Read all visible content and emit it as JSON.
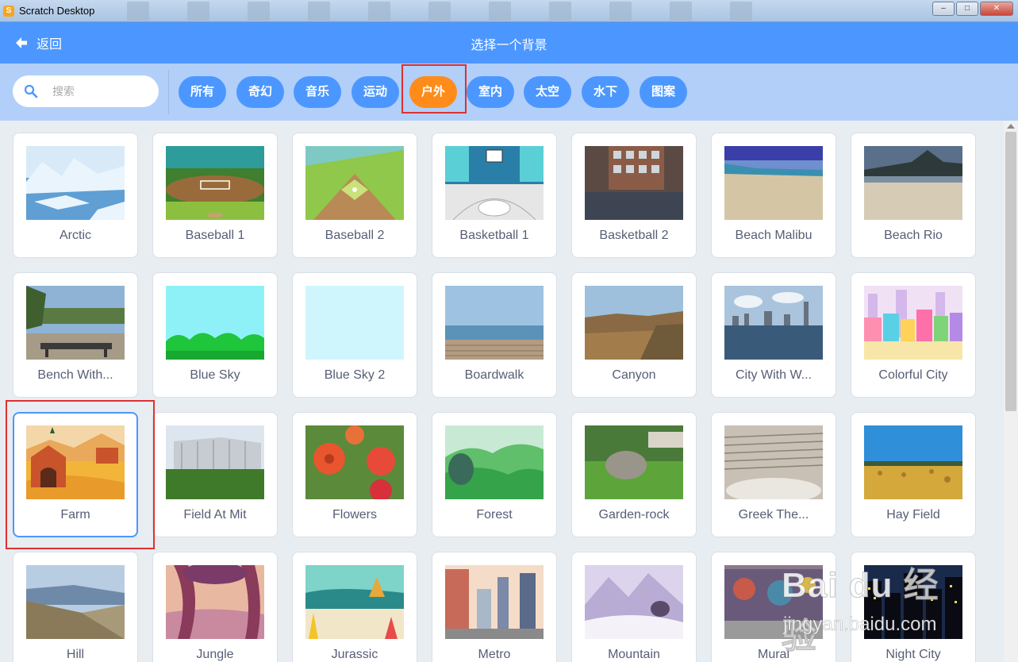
{
  "window": {
    "title": "Scratch Desktop",
    "controls": [
      "minimize-icon",
      "maximize-icon",
      "close-icon"
    ]
  },
  "header": {
    "back_label": "返回",
    "title": "选择一个背景"
  },
  "search": {
    "placeholder": "搜索",
    "value": ""
  },
  "tags": [
    {
      "label": "所有",
      "active": false
    },
    {
      "label": "奇幻",
      "active": false
    },
    {
      "label": "音乐",
      "active": false
    },
    {
      "label": "运动",
      "active": false
    },
    {
      "label": "户外",
      "active": true
    },
    {
      "label": "室内",
      "active": false
    },
    {
      "label": "太空",
      "active": false
    },
    {
      "label": "水下",
      "active": false
    },
    {
      "label": "图案",
      "active": false
    }
  ],
  "backdrops": [
    {
      "label": "Arctic"
    },
    {
      "label": "Baseball 1"
    },
    {
      "label": "Baseball 2"
    },
    {
      "label": "Basketball 1"
    },
    {
      "label": "Basketball 2"
    },
    {
      "label": "Beach Malibu"
    },
    {
      "label": "Beach Rio"
    },
    {
      "label": "Bench With..."
    },
    {
      "label": "Blue Sky"
    },
    {
      "label": "Blue Sky 2"
    },
    {
      "label": "Boardwalk"
    },
    {
      "label": "Canyon"
    },
    {
      "label": "City With W..."
    },
    {
      "label": "Colorful City"
    },
    {
      "label": "Farm",
      "selected": true
    },
    {
      "label": "Field At Mit"
    },
    {
      "label": "Flowers"
    },
    {
      "label": "Forest"
    },
    {
      "label": "Garden-rock"
    },
    {
      "label": "Greek The..."
    },
    {
      "label": "Hay Field"
    },
    {
      "label": "Hill"
    },
    {
      "label": "Jungle"
    },
    {
      "label": "Jurassic"
    },
    {
      "label": "Metro"
    },
    {
      "label": "Mountain"
    },
    {
      "label": "Mural"
    },
    {
      "label": "Night City"
    }
  ],
  "colors": {
    "header": "#4c97ff",
    "filterbar": "#b1cff9",
    "active_tag": "#ff8c1a",
    "highlight": "#e03030"
  },
  "watermark": {
    "main": "Bai du 经验",
    "sub": "jingyan.baidu.com"
  }
}
